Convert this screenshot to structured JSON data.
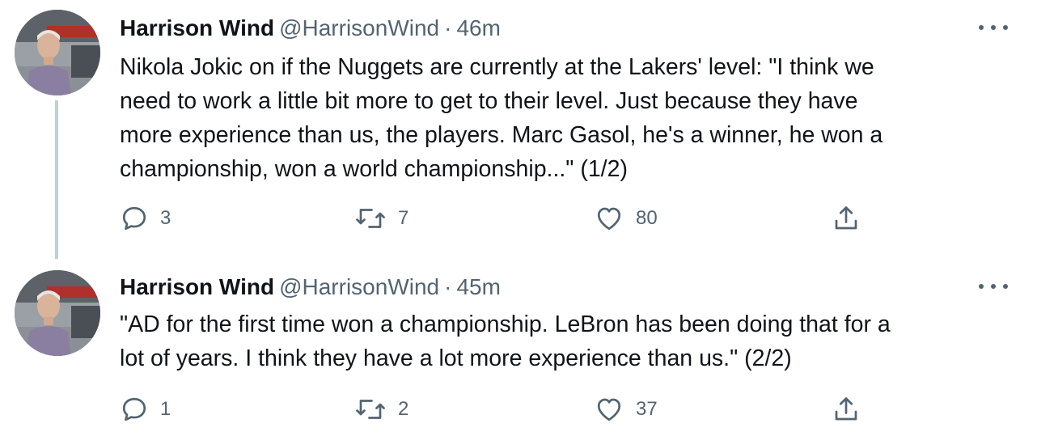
{
  "tweets": [
    {
      "author_name": "Harrison Wind",
      "handle": "@HarrisonWind",
      "separator": "·",
      "time": "46m",
      "text": "Nikola Jokic on if the Nuggets are currently at the Lakers' level: \"I think we\nneed to work a little bit more to get to their level. Just because they have\nmore experience than us, the players. Marc Gasol, he's a winner, he won a\nchampionship, won a world championship...\" (1/2)",
      "replies": "3",
      "retweets": "7",
      "likes": "80"
    },
    {
      "author_name": "Harrison Wind",
      "handle": "@HarrisonWind",
      "separator": "·",
      "time": "45m",
      "text": "\"AD for the first time won a championship. LeBron has been doing that for a\nlot of years. I think they have a lot more experience than us.\" (2/2)",
      "replies": "1",
      "retweets": "2",
      "likes": "37"
    }
  ],
  "icons": {
    "reply": "reply-icon",
    "retweet": "retweet-icon",
    "like": "heart-icon",
    "share": "share-icon",
    "more": "more-options-icon"
  },
  "colors": {
    "text_primary": "#0f1419",
    "text_secondary": "#536471",
    "thread_line": "#c4cfd6"
  }
}
